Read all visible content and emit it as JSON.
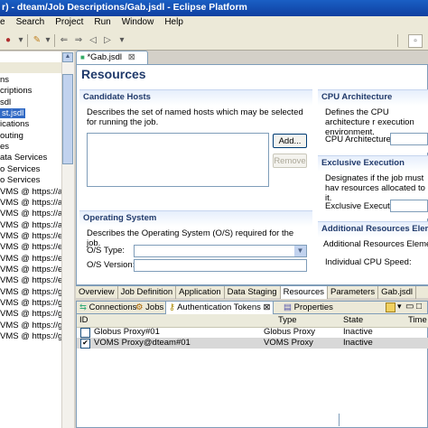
{
  "window": {
    "title": "r) - dteam/Job Descriptions/Gab.jsdl - Eclipse Platform"
  },
  "menu": [
    "e",
    "Search",
    "Project",
    "Run",
    "Window",
    "Help"
  ],
  "left_tree": {
    "items": [
      "ns",
      "criptions",
      "sdl",
      "st.jsdl",
      "ications",
      "outing",
      "es",
      "ata Services",
      "o Services",
      "o Services",
      "VMS @ https://a",
      "VMS @ https://a",
      "VMS @ https://a",
      "VMS @ https://a",
      "VMS @ https://e",
      "VMS @ https://e",
      "VMS @ https://e",
      "VMS @ https://e",
      "VMS @ https://e",
      "VMS @ https://g",
      "VMS @ https://g",
      "VMS @ https://g",
      "VMS @ https://g",
      "VMS @ https://g"
    ],
    "selected_index": 3
  },
  "editor": {
    "tab_label": "*Gab.jsdl",
    "title": "Resources",
    "candidate_hosts": {
      "header": "Candidate Hosts",
      "description": "Describes the set of named hosts which may be selected for running the job.",
      "add_label": "Add...",
      "remove_label": "Remove"
    },
    "operating_system": {
      "header": "Operating System",
      "description": "Describes the Operating System (O/S) required for the job.",
      "os_type_label": "O/S Type:",
      "os_version_label": "O/S Version:"
    },
    "cpu_architecture": {
      "header": "CPU Architecture",
      "description": "Defines the CPU architecture r execution environment.",
      "field_label": "CPU Architecture:"
    },
    "exclusive_execution": {
      "header": "Exclusive Execution",
      "description": "Designates if the job must hav resources allocated to it.",
      "field_label": "Exclusive Execution:"
    },
    "additional_resources": {
      "header": "Additional Resources Eleme",
      "description": "Additional Resources Elements",
      "field_label": "Individual CPU Speed:"
    },
    "pages": [
      "Overview",
      "Job Definition",
      "Application",
      "Data Staging",
      "Resources",
      "Parameters",
      "Gab.jsdl"
    ],
    "active_page": "Resources"
  },
  "views": {
    "tabs": [
      "Connections",
      "Jobs",
      "Authentication Tokens",
      "Properties"
    ],
    "active_tab": "Authentication Tokens",
    "columns": [
      "ID",
      "Type",
      "State",
      "Time"
    ],
    "rows": [
      {
        "id": "Globus Proxy#01",
        "type": "Globus Proxy",
        "state": "Inactive",
        "checked": false
      },
      {
        "id": "VOMS Proxy@dteam#01",
        "type": "VOMS Proxy",
        "state": "Inactive",
        "checked": true
      }
    ]
  }
}
